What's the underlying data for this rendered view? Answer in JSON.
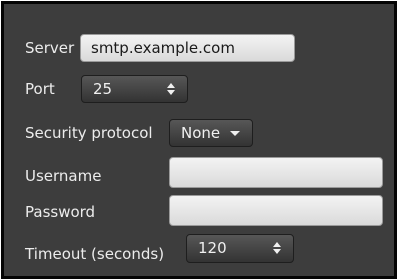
{
  "server": {
    "label": "Server",
    "value": "smtp.example.com"
  },
  "port": {
    "label": "Port",
    "value": "25",
    "icon": "up-down-arrows-icon"
  },
  "security": {
    "label": "Security protocol",
    "value": "None",
    "icon": "dropdown-caret-icon"
  },
  "username": {
    "label": "Username",
    "value": ""
  },
  "password": {
    "label": "Password",
    "value": ""
  },
  "timeout": {
    "label": "Timeout (seconds)",
    "value": "120",
    "icon": "up-down-arrows-icon"
  }
}
